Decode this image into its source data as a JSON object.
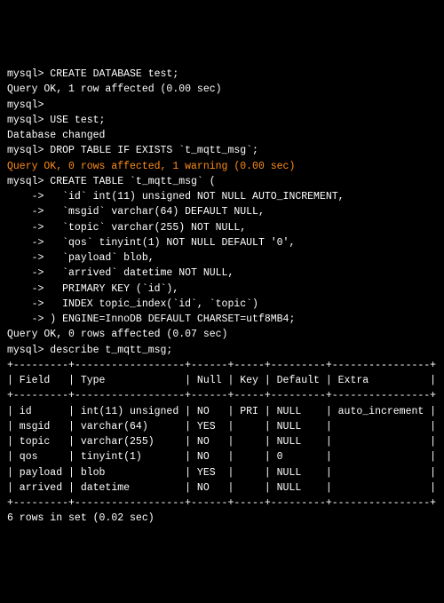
{
  "session": [
    {
      "cls": "",
      "text": "mysql> CREATE DATABASE test;"
    },
    {
      "cls": "",
      "text": "Query OK, 1 row affected (0.00 sec)"
    },
    {
      "cls": "",
      "text": ""
    },
    {
      "cls": "",
      "text": "mysql>"
    },
    {
      "cls": "",
      "text": "mysql> USE test;"
    },
    {
      "cls": "",
      "text": "Database changed"
    },
    {
      "cls": "",
      "text": "mysql> DROP TABLE IF EXISTS `t_mqtt_msg`;"
    },
    {
      "cls": "orange",
      "text": "Query OK, 0 rows affected, 1 warning (0.00 sec)"
    },
    {
      "cls": "",
      "text": ""
    },
    {
      "cls": "",
      "text": "mysql> CREATE TABLE `t_mqtt_msg` ("
    },
    {
      "cls": "",
      "text": "    ->   `id` int(11) unsigned NOT NULL AUTO_INCREMENT,"
    },
    {
      "cls": "",
      "text": "    ->   `msgid` varchar(64) DEFAULT NULL,"
    },
    {
      "cls": "",
      "text": "    ->   `topic` varchar(255) NOT NULL,"
    },
    {
      "cls": "",
      "text": "    ->   `qos` tinyint(1) NOT NULL DEFAULT '0',"
    },
    {
      "cls": "",
      "text": "    ->   `payload` blob,"
    },
    {
      "cls": "",
      "text": "    ->   `arrived` datetime NOT NULL,"
    },
    {
      "cls": "",
      "text": "    ->   PRIMARY KEY (`id`),"
    },
    {
      "cls": "",
      "text": "    ->   INDEX topic_index(`id`, `topic`)"
    },
    {
      "cls": "",
      "text": "    -> ) ENGINE=InnoDB DEFAULT CHARSET=utf8MB4;"
    },
    {
      "cls": "",
      "text": "Query OK, 0 rows affected (0.07 sec)"
    },
    {
      "cls": "",
      "text": ""
    },
    {
      "cls": "",
      "text": "mysql> describe t_mqtt_msg;"
    }
  ],
  "describe": {
    "sep": "+---------+------------------+------+-----+---------+----------------+",
    "header": "| Field   | Type             | Null | Key | Default | Extra          |",
    "rows": [
      "| id      | int(11) unsigned | NO   | PRI | NULL    | auto_increment |",
      "| msgid   | varchar(64)      | YES  |     | NULL    |                |",
      "| topic   | varchar(255)     | NO   |     | NULL    |                |",
      "| qos     | tinyint(1)       | NO   |     | 0       |                |",
      "| payload | blob             | YES  |     | NULL    |                |",
      "| arrived | datetime         | NO   |     | NULL    |                |"
    ],
    "footer": "6 rows in set (0.02 sec)"
  }
}
